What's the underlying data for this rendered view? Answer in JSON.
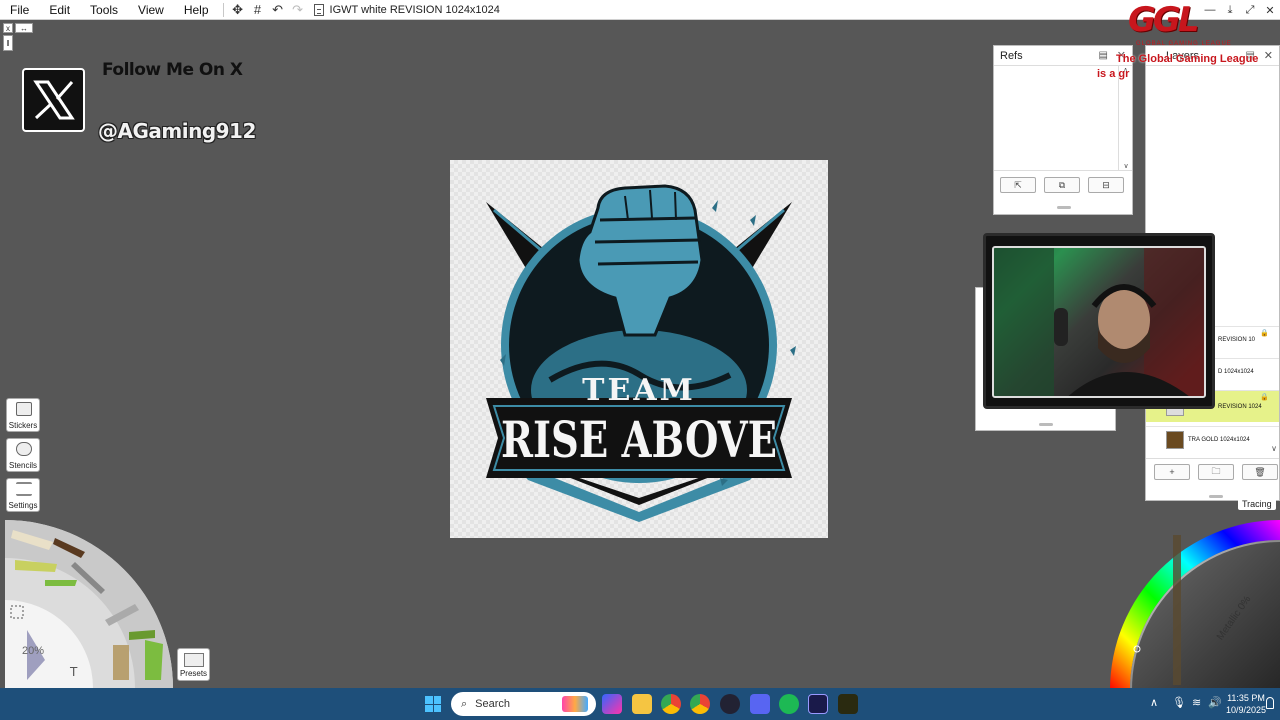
{
  "app": {
    "menu": [
      "File",
      "Edit",
      "Tools",
      "View",
      "Help"
    ],
    "document_title": "IGWT white REVISION 1024x1024"
  },
  "overlay": {
    "follow_text": "Follow Me On X",
    "handle": "@AGaming912",
    "ggl_logo": "GGL",
    "ggl_sub": "GLOBAL GAMING LEAGUE",
    "ggl_tagline_1": "The Global Gaming League",
    "ggl_tagline_2": "is a gr"
  },
  "artwork": {
    "line1": "TEAM",
    "line2": "RISE ABOVE"
  },
  "refs_panel": {
    "title": "Refs"
  },
  "layers_panel": {
    "title": "Layers",
    "rows": [
      {
        "name": "REVISION 10"
      },
      {
        "name": "D 1024x1024"
      },
      {
        "name": "REVISION 1024"
      },
      {
        "name": "TRA GOLD 1024x1024"
      }
    ]
  },
  "left_tools": {
    "stickers": "Stickers",
    "stencils": "Stencils",
    "settings": "Settings",
    "zoom": "20%",
    "presets": "Presets",
    "text_tool_glyph": "T"
  },
  "color_picker": {
    "tracing": "Tracing",
    "metallic": "Metallic 0%"
  },
  "taskbar": {
    "search_placeholder": "Search",
    "time": "11:35 PM",
    "date": "10/9/2025"
  },
  "colors": {
    "workspace": "#575757",
    "accent_red": "#c8161d",
    "artwork_blue": "#3d8ca6",
    "taskbar": "#1e4f7a",
    "selected_layer": "#e6f28a"
  }
}
